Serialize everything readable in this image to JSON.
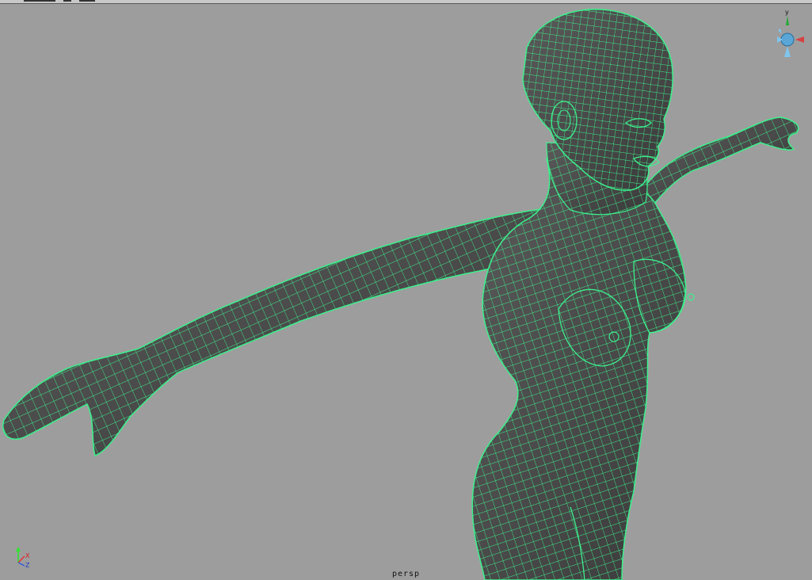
{
  "viewport": {
    "camera_label": "persp",
    "background_color": "#9d9d9d",
    "wireframe_color": "#3cf08c",
    "mesh_color": "#4a4a4a"
  },
  "axis_gizmo": {
    "y_label": "Y",
    "x_label": "X",
    "z_label": "Z",
    "y_color": "#2ee62e",
    "x_color": "#e62e2e",
    "z_color": "#2e5ae6"
  },
  "view_cube": {
    "top_label": "y",
    "icon": "view-compass-icon"
  }
}
